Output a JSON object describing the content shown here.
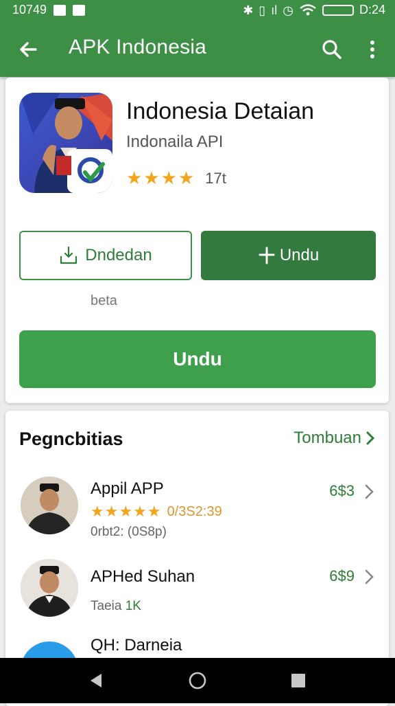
{
  "status_bar": {
    "left_text": "10749",
    "right_text": "D:24"
  },
  "app_bar": {
    "title": "APK Indonesia",
    "back_icon": "arrow-back-icon",
    "search_icon": "search-icon",
    "more_icon": "more-vert-icon"
  },
  "app": {
    "name": "Indonesia Detaian",
    "developer": "Indonaila API",
    "stars": "★★★★",
    "rating_count": "17t",
    "secondary_button": "Dndedan",
    "primary_button": "Undu",
    "beta_label": "beta",
    "install_button": "Undu"
  },
  "related": {
    "title": "Pegncbitias",
    "see_more": "Tombuan",
    "items": [
      {
        "title": "Appil APP",
        "stars": "★★★★★",
        "score": "0/3S2:39",
        "sub": "0rbt2: (0S8p)",
        "price": "6$3"
      },
      {
        "title": "APHed Suhan",
        "sub_gray": "Taeia ",
        "sub_green": "1K",
        "price": "6$9"
      },
      {
        "title": "QH: Darneia",
        "price": ""
      }
    ]
  },
  "colors": {
    "app_bar": "#3c8f45",
    "install_green": "#3e9f4c",
    "dark_green": "#337a3f",
    "star": "#f2a51c"
  }
}
